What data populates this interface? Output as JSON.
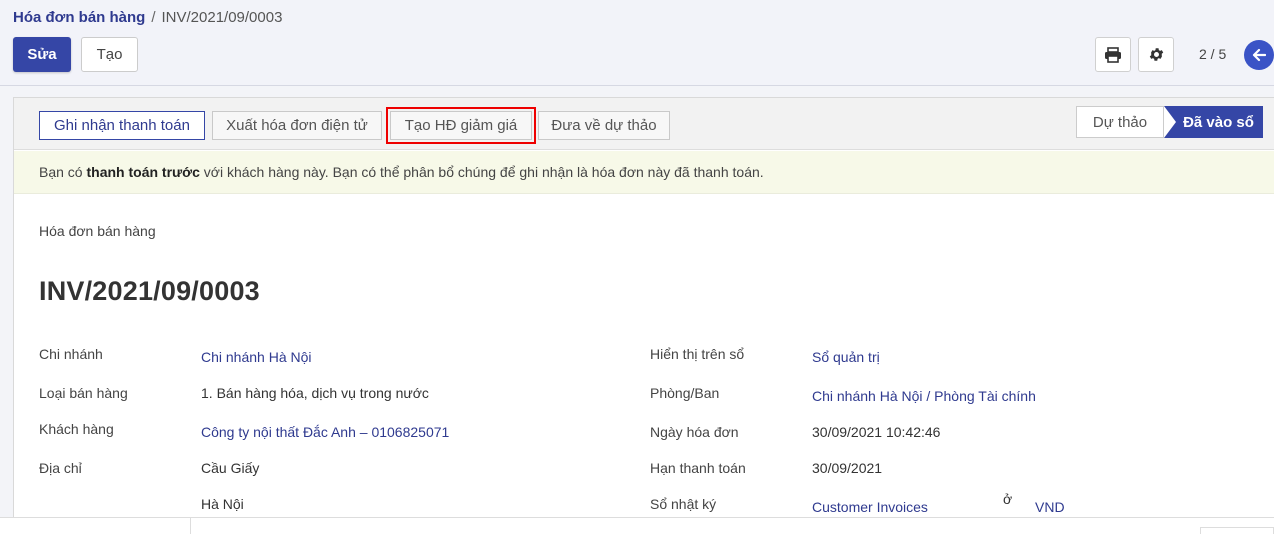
{
  "breadcrumb": {
    "parent": "Hóa đơn bán hàng",
    "separator": "/",
    "current": "INV/2021/09/0003"
  },
  "toolbar": {
    "edit_label": "Sửa",
    "create_label": "Tạo",
    "pager": "2 / 5"
  },
  "actions": {
    "register_payment": "Ghi nhận thanh toán",
    "e_invoice": "Xuất hóa đơn điện tử",
    "credit_note": "Tạo HĐ giảm giá",
    "reset_draft": "Đưa về dự thảo"
  },
  "stages": {
    "draft": "Dự thảo",
    "posted": "Đã vào sổ"
  },
  "alert": {
    "prefix": "Bạn có ",
    "bold": "thanh toán trước",
    "suffix": " với khách hàng này. Bạn có thể phân bổ chúng để ghi nhận là hóa đơn này đã thanh toán."
  },
  "document": {
    "type": "Hóa đơn bán hàng",
    "name": "INV/2021/09/0003"
  },
  "left_fields": {
    "branch_label": "Chi nhánh",
    "branch_value": "Chi nhánh Hà Nội",
    "sale_type_label": "Loại bán hàng",
    "sale_type_value": "1. Bán hàng hóa, dịch vụ trong nước",
    "customer_label": "Khách hàng",
    "customer_value": "Công ty nội thất Đắc Anh – 0106825071",
    "address_label": "Địa chỉ",
    "address_line1": "Cầu Giấy",
    "address_line2": "Hà Nội"
  },
  "right_fields": {
    "ledger_label": "Hiển thị trên sổ",
    "ledger_value": "Sổ quản trị",
    "department_label": "Phòng/Ban",
    "department_value": "Chi nhánh Hà Nội / Phòng Tài chính",
    "invoice_date_label": "Ngày hóa đơn",
    "invoice_date_value": "30/09/2021 10:42:46",
    "due_date_label": "Hạn thanh toán",
    "due_date_value": "30/09/2021",
    "journal_label": "Sổ nhật ký",
    "journal_value": "Customer Invoices",
    "currency_in": "ở",
    "currency_value": "VND"
  },
  "colors": {
    "primary": "#3546a6",
    "highlight": "#e00000",
    "alert_bg": "#f7f9e8"
  },
  "icons": [
    "print-icon",
    "gear-icon",
    "arrow-left-icon"
  ]
}
